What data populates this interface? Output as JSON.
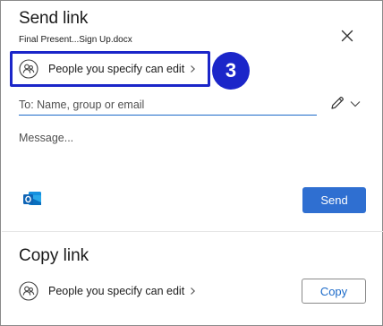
{
  "dialog": {
    "title": "Send link",
    "filename": "Final Present...Sign Up.docx"
  },
  "permission": {
    "label": "People you specify can edit"
  },
  "annotation": {
    "step_number": "3",
    "color": "#1b26c9"
  },
  "recipient": {
    "placeholder": "To: Name, group or email",
    "value": ""
  },
  "message": {
    "placeholder": "Message...",
    "value": ""
  },
  "send": {
    "label": "Send",
    "color": "#2f6fd1"
  },
  "copy_section": {
    "title": "Copy link",
    "permission_label": "People you specify can edit",
    "button_label": "Copy"
  },
  "icons": {
    "close": "close-icon",
    "people": "people-icon",
    "chevron": "chevron-right-icon",
    "pencil": "pencil-icon",
    "dropdown": "chevron-down-icon",
    "outlook": "outlook-icon"
  }
}
